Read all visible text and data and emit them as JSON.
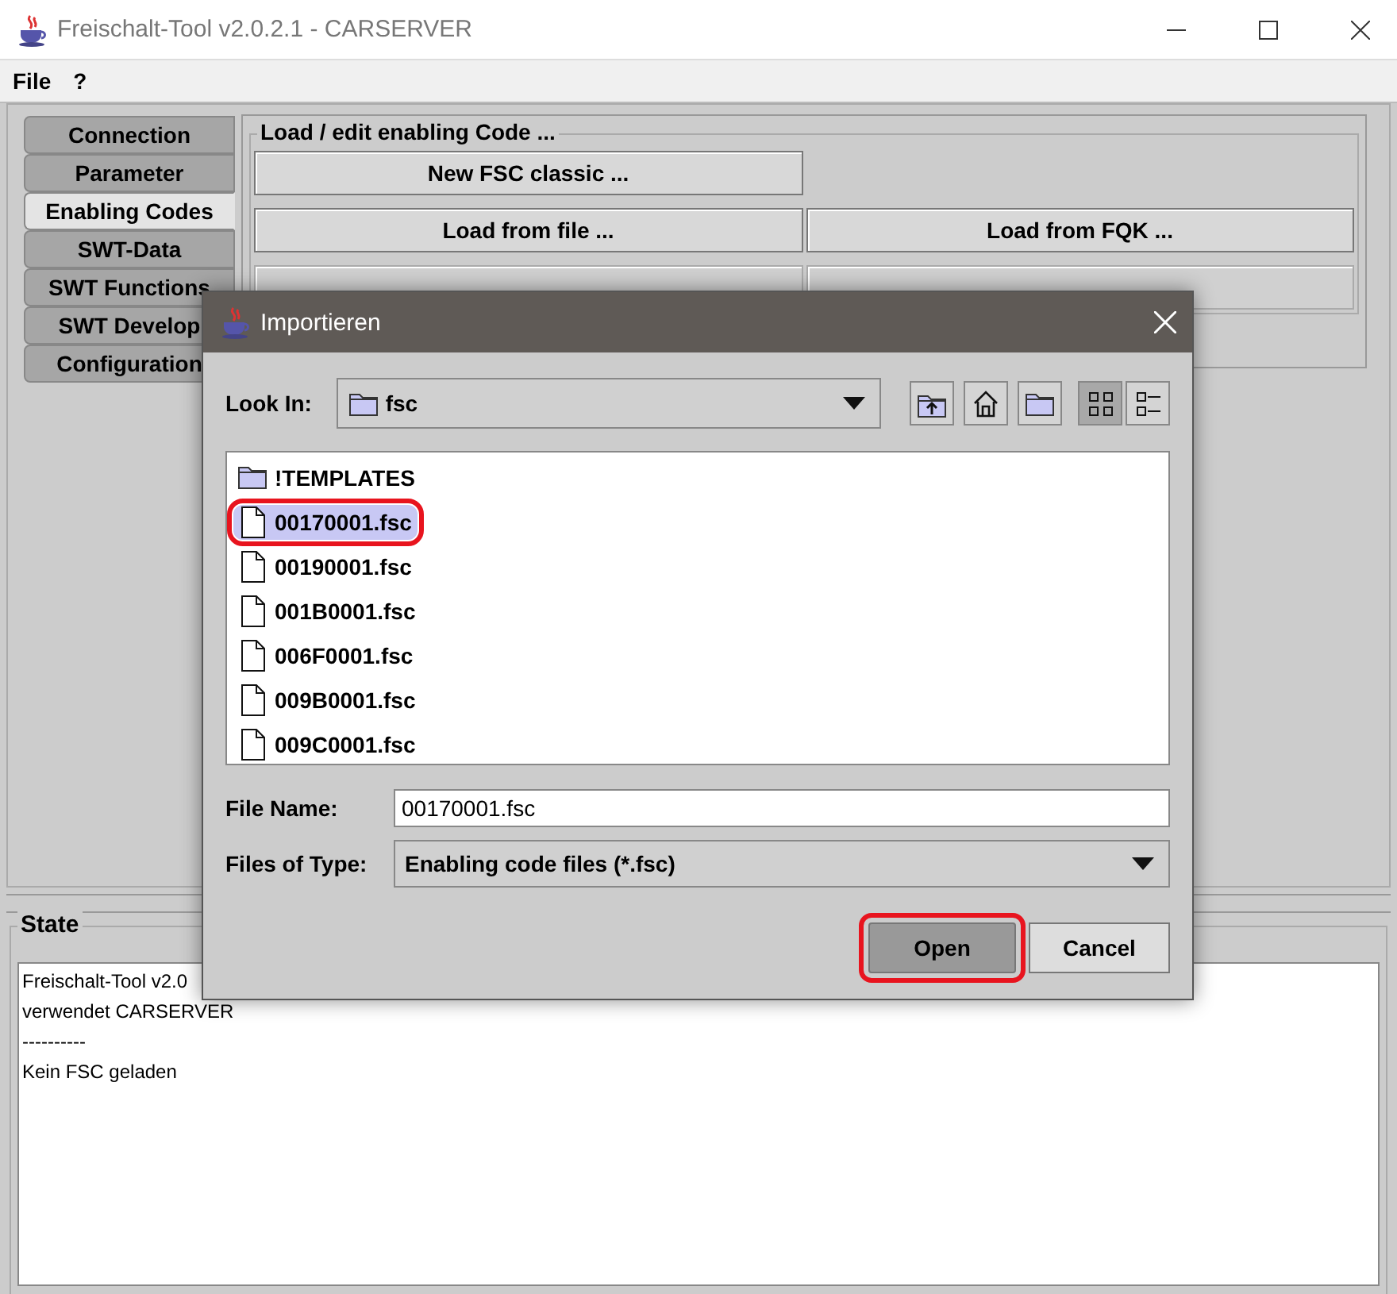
{
  "window": {
    "title": "Freischalt-Tool v2.0.2.1 - CARSERVER"
  },
  "menu": [
    {
      "label": "File"
    },
    {
      "label": "?"
    }
  ],
  "tabs": [
    {
      "label": "Connection",
      "selected": false
    },
    {
      "label": "Parameter",
      "selected": false
    },
    {
      "label": "Enabling Codes",
      "selected": true
    },
    {
      "label": "SWT-Data",
      "selected": false
    },
    {
      "label": "SWT Functions",
      "selected": false
    },
    {
      "label": "SWT Develop",
      "selected": false
    },
    {
      "label": "Configuration",
      "selected": false
    }
  ],
  "group": {
    "title": "Load / edit enabling Code ...",
    "rows": [
      [
        {
          "label": "New FSC classic ...",
          "disabled": false
        }
      ],
      [
        {
          "label": "Load from file ...",
          "disabled": false
        },
        {
          "label": "Load from FQK ...",
          "disabled": false
        }
      ],
      [
        {
          "disabled": true
        },
        {
          "disabled": true
        }
      ]
    ]
  },
  "state": {
    "title": "State",
    "lines": [
      "Freischalt-Tool v2.0",
      "verwendet CARSERVER",
      "----------",
      "Kein FSC geladen"
    ]
  },
  "dialog": {
    "title": "Importieren",
    "look_in": {
      "label": "Look In:",
      "value": "fsc"
    },
    "views": [
      {
        "kind": "list",
        "selected": true
      },
      {
        "kind": "details",
        "selected": false
      }
    ],
    "files": [
      {
        "name": "!TEMPLATES",
        "kind": "folder",
        "selected": false,
        "annotated": false
      },
      {
        "name": "00170001.fsc",
        "kind": "file",
        "selected": true,
        "annotated": true
      },
      {
        "name": "00190001.fsc",
        "kind": "file",
        "selected": false,
        "annotated": false
      },
      {
        "name": "001B0001.fsc",
        "kind": "file",
        "selected": false,
        "annotated": false
      },
      {
        "name": "006F0001.fsc",
        "kind": "file",
        "selected": false,
        "annotated": false
      },
      {
        "name": "009B0001.fsc",
        "kind": "file",
        "selected": false,
        "annotated": false
      },
      {
        "name": "009C0001.fsc",
        "kind": "file",
        "selected": false,
        "annotated": false
      }
    ],
    "file_name": {
      "label": "File Name:",
      "value": "00170001.fsc"
    },
    "file_type": {
      "label": "Files of Type:",
      "value": "Enabling code files (*.fsc)"
    },
    "buttons": [
      {
        "label": "Open",
        "pressed": true,
        "annotated": true
      },
      {
        "label": "Cancel",
        "pressed": false,
        "annotated": false
      }
    ]
  }
}
